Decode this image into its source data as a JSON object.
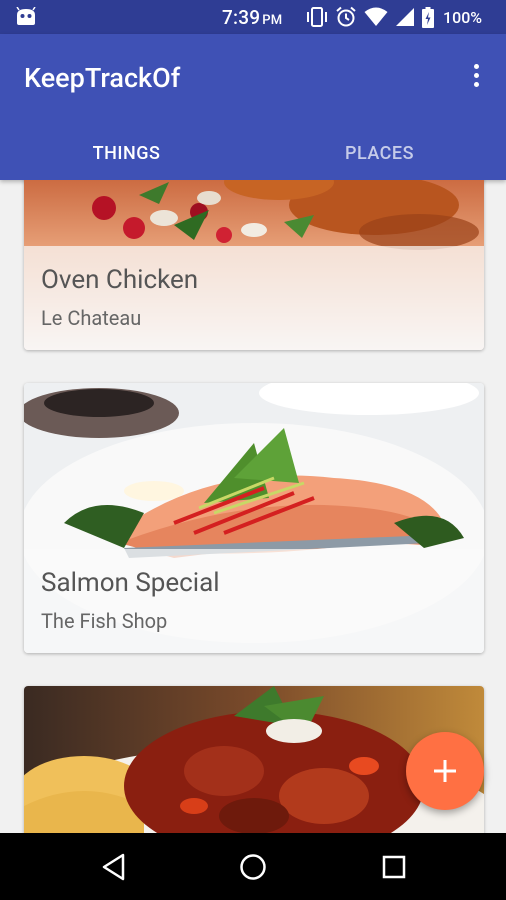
{
  "status_bar": {
    "time": "7:39",
    "ampm": "PM",
    "battery": "100%",
    "icons": [
      "android-icon",
      "vibrate-icon",
      "alarm-icon",
      "wifi-icon",
      "signal-icon",
      "battery-icon"
    ]
  },
  "app_bar": {
    "title": "KeepTrackOf",
    "tabs": [
      {
        "label": "THINGS",
        "selected": true
      },
      {
        "label": "PLACES",
        "selected": false
      }
    ]
  },
  "cards": [
    {
      "title": "Oven Chicken",
      "subtitle": "Le Chateau"
    },
    {
      "title": "Salmon Special",
      "subtitle": "The Fish Shop"
    },
    {
      "title": "",
      "subtitle": ""
    }
  ],
  "fab": {
    "icon": "add-icon"
  },
  "nav_bar": {
    "buttons": [
      "back-icon",
      "home-icon",
      "recents-icon"
    ]
  },
  "colors": {
    "status_bar": "#2f3d94",
    "app_bar": "#3f51b5",
    "accent": "#ff7043",
    "background": "#f1f1f1",
    "nav_bar": "#000000"
  }
}
